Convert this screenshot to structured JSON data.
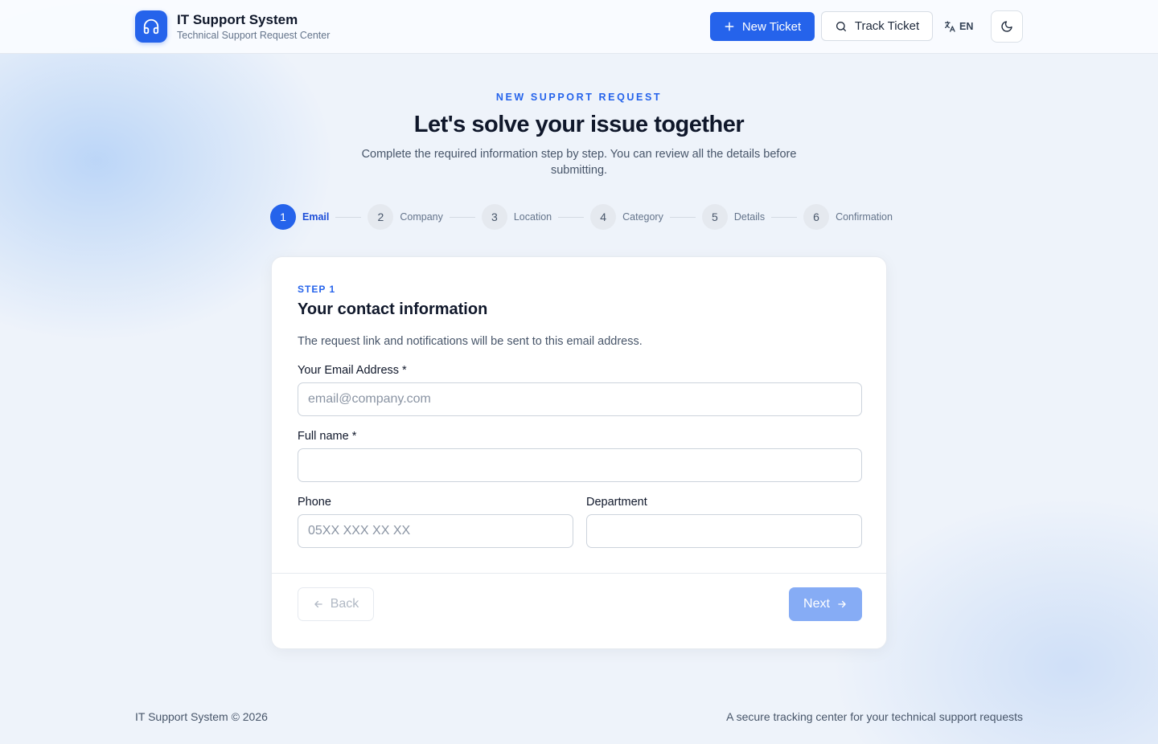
{
  "header": {
    "brand_title": "IT Support System",
    "brand_subtitle": "Technical Support Request Center",
    "new_ticket": "New Ticket",
    "track_ticket": "Track Ticket",
    "language": "EN"
  },
  "hero": {
    "eyebrow": "NEW SUPPORT REQUEST",
    "title": "Let's solve your issue together",
    "description": "Complete the required information step by step. You can review all the details before submitting."
  },
  "stepper": {
    "steps": [
      {
        "num": "1",
        "label": "Email"
      },
      {
        "num": "2",
        "label": "Company"
      },
      {
        "num": "3",
        "label": "Location"
      },
      {
        "num": "4",
        "label": "Category"
      },
      {
        "num": "5",
        "label": "Details"
      },
      {
        "num": "6",
        "label": "Confirmation"
      }
    ],
    "active": 1
  },
  "form": {
    "step_label": "STEP 1",
    "title": "Your contact information",
    "description": "The request link and notifications will be sent to this email address.",
    "email_label": "Your Email Address *",
    "email_placeholder": "email@company.com",
    "email_value": "",
    "fullname_label": "Full name *",
    "fullname_value": "",
    "phone_label": "Phone",
    "phone_placeholder": "05XX XXX XX XX",
    "phone_value": "",
    "department_label": "Department",
    "department_value": "",
    "back": "Back",
    "next": "Next"
  },
  "footer": {
    "copyright": "IT Support System © 2026",
    "tagline": "A secure tracking center for your technical support requests"
  },
  "colors": {
    "accent": "#2563eb",
    "next_disabled": "#86acf5"
  }
}
